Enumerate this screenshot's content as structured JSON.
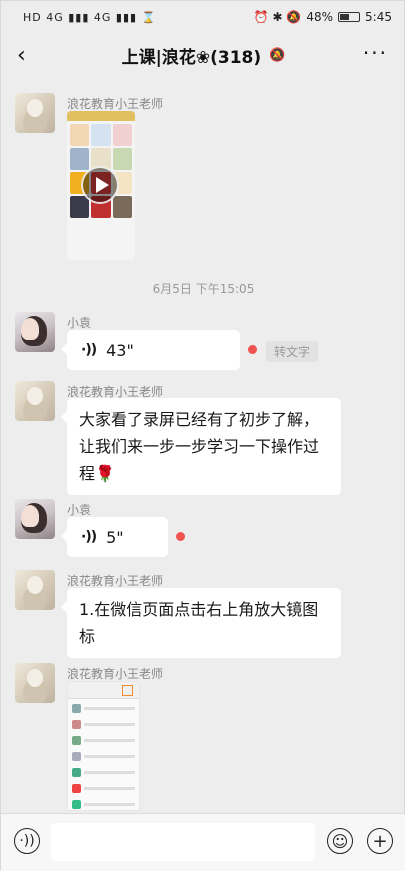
{
  "status_bar": {
    "left_icons": "HD 4G ▮▮▮ 4G ▮▮▮ ⌛",
    "right_icons": "⏰ ✱ 🔕",
    "battery_percent": "48%",
    "battery_level": 0.48,
    "time": "5:45"
  },
  "header": {
    "back_icon": "‹",
    "title": "上课|浪花❀(318)",
    "mute_icon": "🔕",
    "more_icon": "···"
  },
  "messages": [
    {
      "sender": "浪花教育小王老师",
      "type": "video"
    },
    {
      "timestamp": "6月5日 下午15:05"
    },
    {
      "sender": "小袁",
      "type": "voice",
      "duration": "43\"",
      "to_text": "转文字"
    },
    {
      "sender": "浪花教育小王老师",
      "type": "text",
      "text": "大家看了录屏已经有了初步了解，让我们来一步一步学习一下操作过程🌹"
    },
    {
      "sender": "小袁",
      "type": "voice",
      "duration": "5\""
    },
    {
      "sender": "浪花教育小王老师",
      "type": "text",
      "text": "1.在微信页面点击右上角放大镜图标"
    },
    {
      "sender": "浪花教育小王老师",
      "type": "image"
    }
  ],
  "input_bar": {
    "voice_icon": "voice-mode-icon",
    "emoji_icon": "emoji-icon",
    "plus_icon": "plus-icon",
    "placeholder": ""
  },
  "colors": {
    "background": "#ededed",
    "unread_dot": "#f25252",
    "bubble": "#ffffff"
  }
}
